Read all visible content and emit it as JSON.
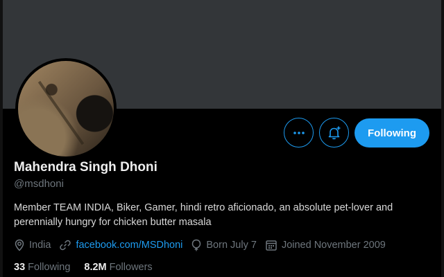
{
  "profile": {
    "name": "Mahendra Singh Dhoni",
    "handle": "@msdhoni",
    "bio": "Member TEAM INDIA, Biker, Gamer, hindi retro aficionado, an absolute pet-lover and perennially hungry for chicken butter masala",
    "location": "India",
    "website": "facebook.com/MSDhoni",
    "birthday": "Born July 7",
    "joined": "Joined November 2009"
  },
  "actions": {
    "follow_label": "Following",
    "more_icon": "more-icon",
    "notify_icon": "bell-plus-icon"
  },
  "stats": {
    "following_count": "33",
    "following_label": "Following",
    "followers_count": "8.2M",
    "followers_label": "Followers"
  },
  "colors": {
    "accent": "#1d9bf0",
    "banner": "#333639",
    "background": "#000000",
    "secondary_text": "#6e767d"
  }
}
